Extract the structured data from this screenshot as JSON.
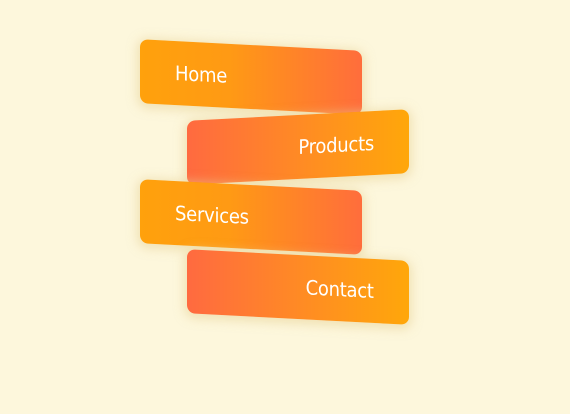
{
  "menu": {
    "items": [
      {
        "label": "Home"
      },
      {
        "label": "Products"
      },
      {
        "label": "Services"
      },
      {
        "label": "Contact"
      }
    ]
  },
  "colors": {
    "background": "#fdf7dc",
    "orange": "#ffa10c",
    "coral": "#ff6d3c",
    "text": "#ffffff"
  }
}
